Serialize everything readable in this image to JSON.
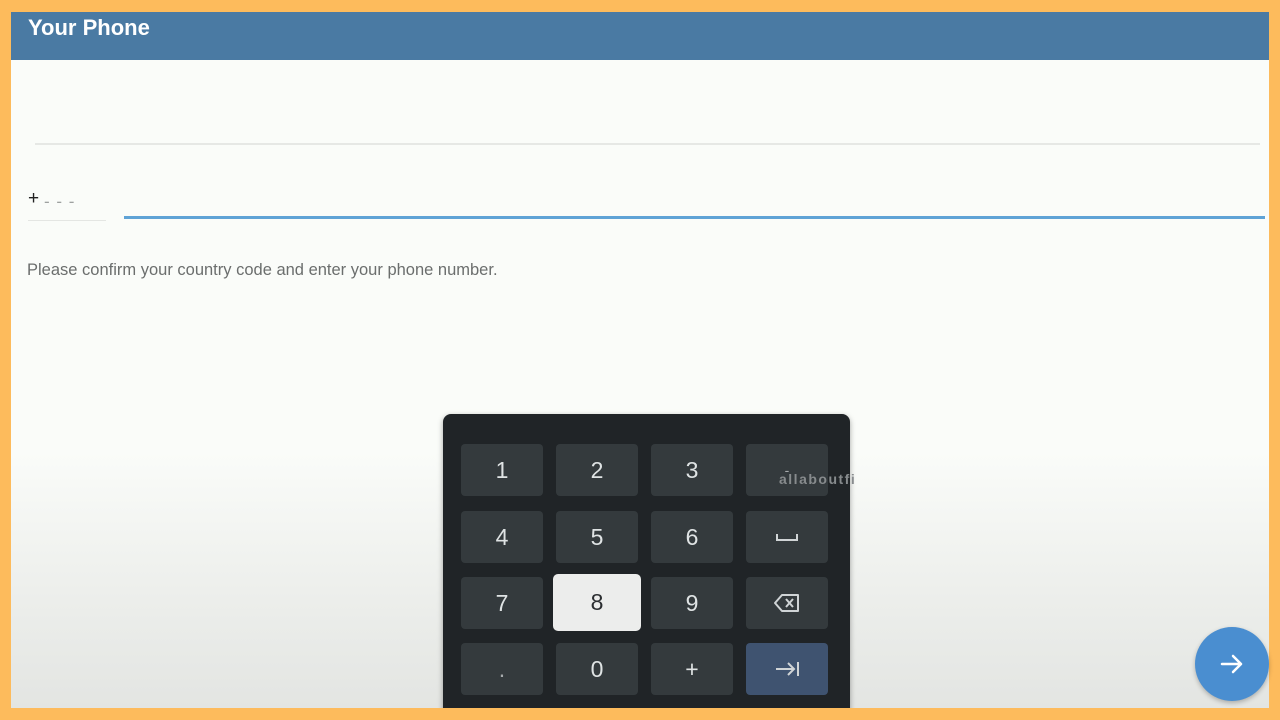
{
  "header": {
    "title": "Your Phone"
  },
  "country_code": {
    "prefix": "+",
    "placeholder": "- - -"
  },
  "phone_number": {
    "value": ""
  },
  "hint_text": "Please confirm your country code and enter your phone number.",
  "keypad": {
    "keys": [
      "1",
      "2",
      "3",
      "-",
      "4",
      "5",
      "6",
      "␣",
      "7",
      "8",
      "9",
      "⌫",
      ".",
      "0",
      "+",
      "⇥"
    ],
    "pressed_key": "8"
  },
  "watermark": "allaboutfi",
  "next_button": {
    "icon": "arrow-right-icon"
  },
  "colors": {
    "header": "#4a7aa3",
    "accent_line": "#5fa3d6",
    "fab": "#4a8ed0",
    "keypad_bg": "#202427",
    "border": "#fdbb5c"
  }
}
